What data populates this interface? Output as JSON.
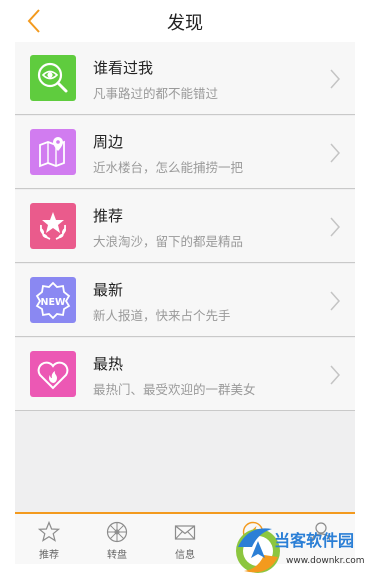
{
  "header": {
    "title": "发现"
  },
  "rows": [
    {
      "title": "谁看过我",
      "subtitle": "凡事路过的都不能错过",
      "color": "#5fcc3e",
      "icon": "eye-magnifier-icon"
    },
    {
      "title": "周边",
      "subtitle": "近水楼台，怎么能捕捞一把",
      "color": "#d17cf0",
      "icon": "map-pin-icon"
    },
    {
      "title": "推荐",
      "subtitle": "大浪淘沙，留下的都是精品",
      "color": "#ea5b8c",
      "icon": "star-laurel-icon"
    },
    {
      "title": "最新",
      "subtitle": "新人报道，快来占个先手",
      "color": "#8a88f2",
      "icon": "new-badge-icon"
    },
    {
      "title": "最热",
      "subtitle": "最热门、最受欢迎的一群美女",
      "color": "#ec58b4",
      "icon": "heart-flame-icon"
    }
  ],
  "tabs": [
    {
      "label": "推荐",
      "icon": "star-outline-icon"
    },
    {
      "label": "转盘",
      "icon": "wheel-icon"
    },
    {
      "label": "信息",
      "icon": "envelope-icon"
    },
    {
      "label": "",
      "icon": "compass-icon",
      "active": true
    },
    {
      "label": "",
      "icon": "user-icon"
    }
  ],
  "watermark": {
    "name": "当客软件园",
    "url": "www.downkr.com"
  },
  "colors": {
    "accent": "#f39a1e"
  }
}
